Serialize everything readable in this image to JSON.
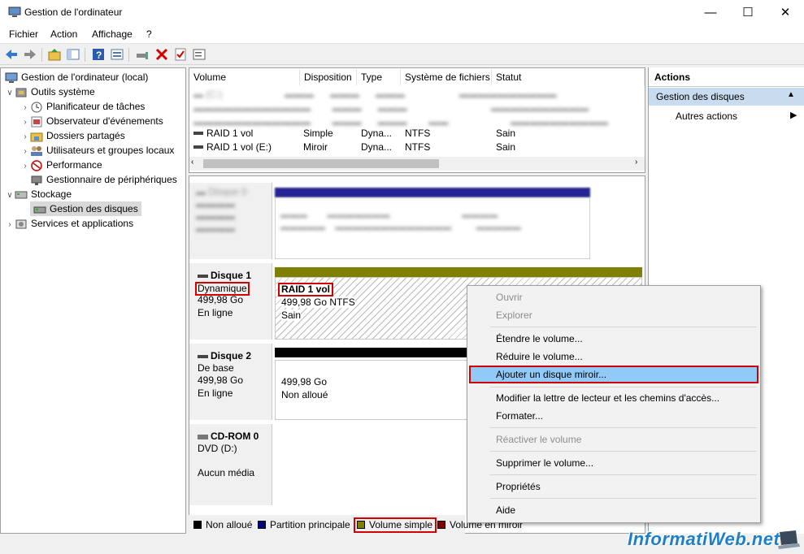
{
  "window": {
    "title": "Gestion de l'ordinateur"
  },
  "menu": [
    "Fichier",
    "Action",
    "Affichage",
    "?"
  ],
  "toolbar": {
    "icons": [
      "back-icon",
      "forward-icon",
      "up-folder-icon",
      "show-hide-tree-icon",
      "help-icon",
      "properties-icon",
      "connect-icon",
      "delete-icon",
      "check-icon",
      "console-icon"
    ]
  },
  "tree": {
    "root": "Gestion de l'ordinateur (local)",
    "outils": "Outils système",
    "planif": "Planificateur de tâches",
    "observ": "Observateur d'événements",
    "dossiers": "Dossiers partagés",
    "users": "Utilisateurs et groupes locaux",
    "perf": "Performance",
    "periph": "Gestionnaire de périphériques",
    "stockage": "Stockage",
    "disques": "Gestion des disques",
    "services": "Services et applications"
  },
  "volumes": {
    "headers": [
      "Volume",
      "Disposition",
      "Type",
      "Système de fichiers",
      "Statut"
    ],
    "rows": [
      [
        "RAID 1 vol",
        "Simple",
        "Dyna...",
        "NTFS",
        "Sain"
      ],
      [
        "RAID 1 vol (E:)",
        "Miroir",
        "Dyna...",
        "NTFS",
        "Sain"
      ]
    ]
  },
  "disk1": {
    "name": "Disque 1",
    "type": "Dynamique",
    "size": "499,98 Go",
    "state": "En ligne",
    "vol_name": "RAID 1 vol",
    "vol_size": "499,98 Go NTFS",
    "vol_state": "Sain"
  },
  "disk2": {
    "name": "Disque 2",
    "type": "De base",
    "size": "499,98 Go",
    "state": "En ligne",
    "vol_size": "499,98 Go",
    "vol_state": "Non alloué"
  },
  "cdrom": {
    "name": "CD-ROM 0",
    "type": "DVD (D:)",
    "state": "Aucun média"
  },
  "legend": {
    "items": [
      "Non alloué",
      "Partition principale",
      "Volume simple",
      "Volume en miroir"
    ],
    "colors": [
      "#000000",
      "#00007f",
      "#808000",
      "#800000"
    ]
  },
  "actions": {
    "header": "Actions",
    "section": "Gestion des disques",
    "more": "Autres actions"
  },
  "context_menu": {
    "ouvrir": "Ouvrir",
    "explorer": "Explorer",
    "etendre": "Étendre le volume...",
    "reduire": "Réduire le volume...",
    "ajouter": "Ajouter un disque miroir...",
    "modifier": "Modifier la lettre de lecteur et les chemins d'accès...",
    "formater": "Formater...",
    "reactiver": "Réactiver le volume",
    "supprimer": "Supprimer le volume...",
    "proprietes": "Propriétés",
    "aide": "Aide"
  },
  "watermark": "InformatiWeb.net",
  "colors": {
    "selection": "#cce8ff",
    "hover": "#91c9f7",
    "highlight_red": "#d40000",
    "olive": "#808000"
  }
}
